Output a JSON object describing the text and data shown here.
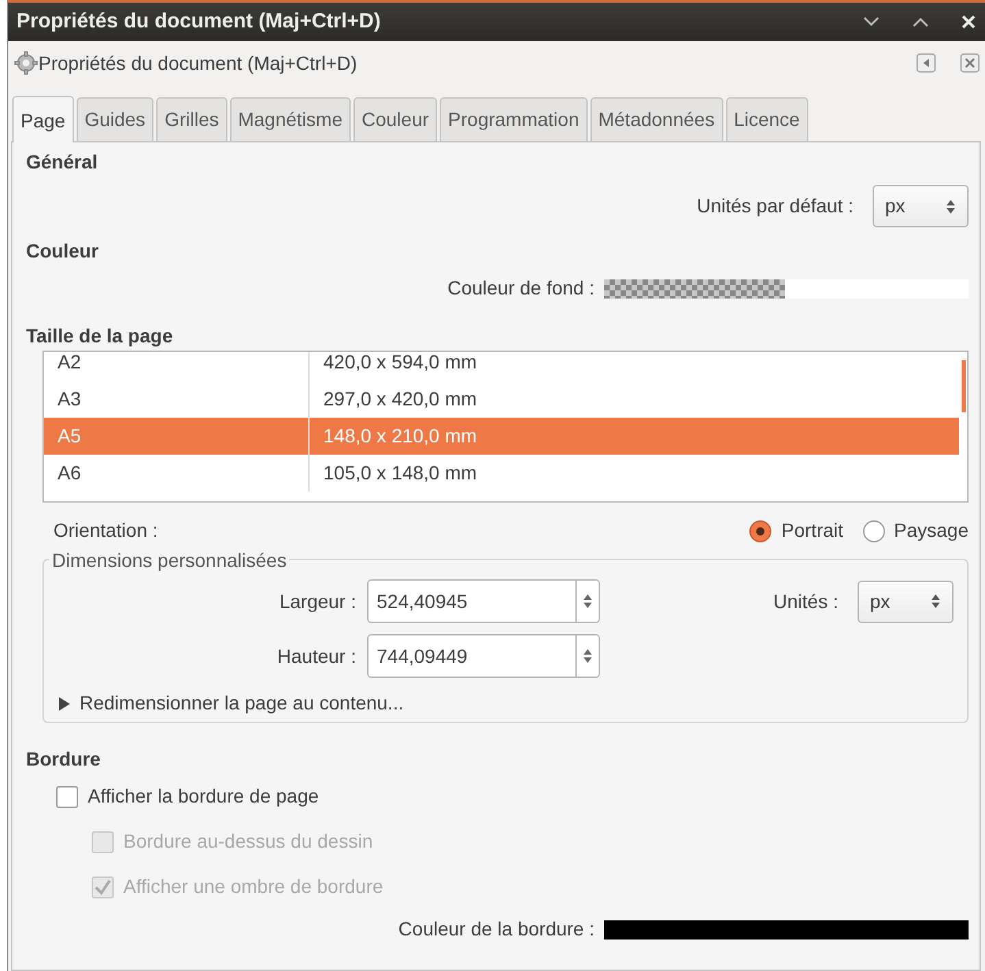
{
  "window": {
    "title": "Propriétés du document (Maj+Ctrl+D)"
  },
  "dialog": {
    "title": "Propriétés du document (Maj+Ctrl+D)"
  },
  "tabs": [
    {
      "label": "Page",
      "selected": true
    },
    {
      "label": "Guides",
      "selected": false
    },
    {
      "label": "Grilles",
      "selected": false
    },
    {
      "label": "Magnétisme",
      "selected": false
    },
    {
      "label": "Couleur",
      "selected": false
    },
    {
      "label": "Programmation",
      "selected": false
    },
    {
      "label": "Métadonnées",
      "selected": false
    },
    {
      "label": "Licence",
      "selected": false
    }
  ],
  "general": {
    "heading": "Général",
    "units_label": "Unités par défaut :",
    "units_value": "px"
  },
  "color": {
    "heading": "Couleur",
    "background_label": "Couleur de fond :"
  },
  "page_size": {
    "heading": "Taille de la page",
    "rows": [
      {
        "name": "A2",
        "size": "420,0 x 594,0 mm",
        "selected": false
      },
      {
        "name": "A3",
        "size": "297,0 x 420,0 mm",
        "selected": false
      },
      {
        "name": "A5",
        "size": "148,0 x 210,0 mm",
        "selected": true
      },
      {
        "name": "A6",
        "size": "105,0 x 148,0 mm",
        "selected": false
      }
    ],
    "orientation_label": "Orientation :",
    "orientation_options": [
      {
        "label": "Portrait",
        "selected": true
      },
      {
        "label": "Paysage",
        "selected": false
      }
    ],
    "custom": {
      "legend": "Dimensions personnalisées",
      "width_label": "Largeur :",
      "width_value": "524,40945",
      "height_label": "Hauteur :",
      "height_value": "744,09449",
      "units_label": "Unités :",
      "units_value": "px",
      "resize": {
        "label": "Redimensionner la page au contenu...",
        "expanded": false
      }
    }
  },
  "border": {
    "heading": "Bordure",
    "options": [
      {
        "label": "Afficher la bordure de page",
        "checked": false,
        "disabled": false,
        "children": [
          {
            "label": "Bordure au-dessus du dessin",
            "checked": false,
            "disabled": true
          },
          {
            "label": "Afficher une ombre de bordure",
            "checked": true,
            "disabled": true
          }
        ]
      }
    ],
    "color_label": "Couleur de la bordure :"
  }
}
